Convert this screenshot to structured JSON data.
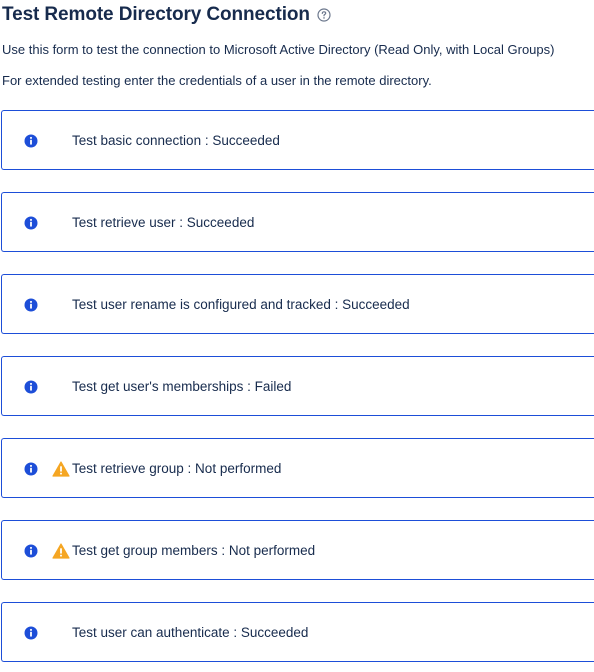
{
  "page": {
    "title": "Test Remote Directory Connection",
    "help_icon": "help-circle-icon",
    "description_line1": "Use this form to test the connection to Microsoft Active Directory (Read Only, with Local Groups)",
    "description_line2": "For extended testing enter the credentials of a user in the remote directory."
  },
  "colors": {
    "border": "#1d4ed8",
    "info_icon": "#1d4ed8",
    "warning_icon": "#f5a623",
    "text": "#172b4d"
  },
  "results": [
    {
      "text": "Test basic connection : Succeeded",
      "icon": "info-icon",
      "warning": false
    },
    {
      "text": "Test retrieve user : Succeeded",
      "icon": "info-icon",
      "warning": false
    },
    {
      "text": "Test user rename is configured and tracked : Succeeded",
      "icon": "info-icon",
      "warning": false
    },
    {
      "text": "Test get user's memberships : Failed",
      "icon": "info-icon",
      "warning": false
    },
    {
      "text": "Test retrieve group : Not performed",
      "icon": "info-icon",
      "warning": true
    },
    {
      "text": "Test get group members : Not performed",
      "icon": "info-icon",
      "warning": true
    },
    {
      "text": "Test user can authenticate : Succeeded",
      "icon": "info-icon",
      "warning": false
    }
  ]
}
